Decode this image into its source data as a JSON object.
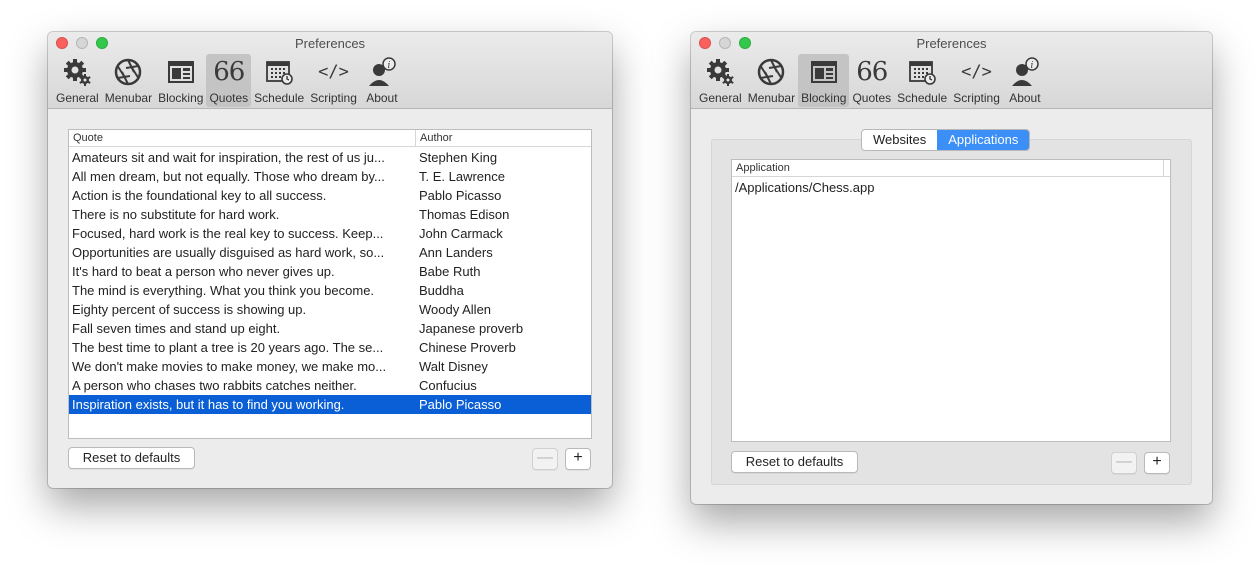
{
  "toolbar_items": [
    {
      "id": "general",
      "label": "General",
      "icon": "gear-icon"
    },
    {
      "id": "menubar",
      "label": "Menubar",
      "icon": "aperture-icon"
    },
    {
      "id": "blocking",
      "label": "Blocking",
      "icon": "browser-window-icon"
    },
    {
      "id": "quotes",
      "label": "Quotes",
      "icon": "quote-66-icon"
    },
    {
      "id": "schedule",
      "label": "Schedule",
      "icon": "calendar-clock-icon"
    },
    {
      "id": "scripting",
      "label": "Scripting",
      "icon": "code-icon"
    },
    {
      "id": "about",
      "label": "About",
      "icon": "person-info-icon"
    }
  ],
  "quotes_window": {
    "title": "Preferences",
    "selected_tab": "Quotes",
    "table": {
      "columns": [
        "Quote",
        "Author"
      ],
      "rows": [
        {
          "quote": "Amateurs sit and wait for inspiration, the rest of us ju...",
          "author": "Stephen King"
        },
        {
          "quote": "All men dream, but not equally. Those who dream by...",
          "author": "T. E. Lawrence"
        },
        {
          "quote": "Action is the foundational key to all success.",
          "author": "Pablo Picasso"
        },
        {
          "quote": "There is no substitute for hard work.",
          "author": "Thomas Edison"
        },
        {
          "quote": "Focused, hard work is the real key to success. Keep...",
          "author": "John Carmack"
        },
        {
          "quote": "Opportunities are usually disguised as hard work, so...",
          "author": "Ann Landers"
        },
        {
          "quote": "It's hard to beat a person who never gives up.",
          "author": "Babe Ruth"
        },
        {
          "quote": "The mind is everything. What you think you become.",
          "author": "Buddha"
        },
        {
          "quote": "Eighty percent of success is showing up.",
          "author": "Woody Allen"
        },
        {
          "quote": "Fall seven times and stand up eight.",
          "author": "Japanese proverb"
        },
        {
          "quote": "The best time to plant a tree is 20 years ago. The se...",
          "author": "Chinese Proverb"
        },
        {
          "quote": "We don't make movies to make money, we make mo...",
          "author": "Walt Disney"
        },
        {
          "quote": "A person who chases two rabbits catches neither.",
          "author": "Confucius"
        },
        {
          "quote": "Inspiration exists, but it has to find you working.",
          "author": "Pablo Picasso"
        }
      ],
      "selected_row": 13
    },
    "reset_label": "Reset to defaults",
    "remove_label": "—",
    "add_label": "+"
  },
  "blocking_window": {
    "title": "Preferences",
    "selected_tab": "Blocking",
    "segments": [
      "Websites",
      "Applications"
    ],
    "active_segment": "Applications",
    "table": {
      "columns": [
        "Application"
      ],
      "rows": [
        "/Applications/Chess.app"
      ]
    },
    "reset_label": "Reset to defaults",
    "remove_label": "—",
    "add_label": "+"
  },
  "colors": {
    "selection": "#0a5fd6",
    "segment_active": "#3b8ff6",
    "close": "#fc605c",
    "zoom": "#34c84a"
  }
}
